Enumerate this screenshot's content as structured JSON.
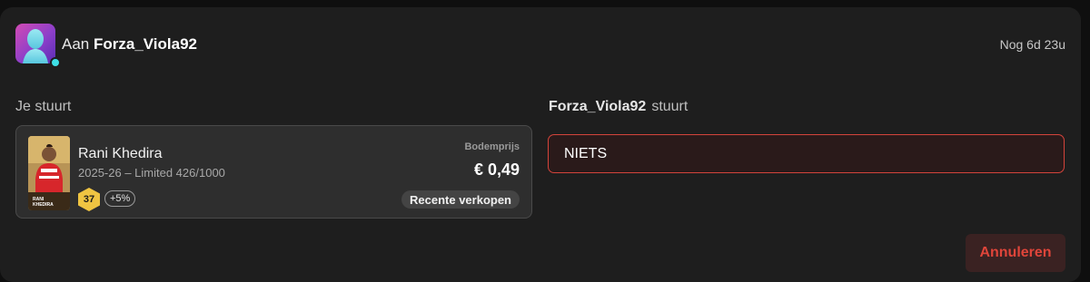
{
  "header": {
    "to_prefix": "Aan",
    "recipient": "Forza_Viola92",
    "time_left": "Nog 6d 23u",
    "avatar_icon": "person-silhouette-icon",
    "online_color": "#3ee0e6"
  },
  "you_send": {
    "label": "Je stuurt",
    "card": {
      "player_name": "Rani Khedira",
      "meta": "2025-26 – Limited 426/1000",
      "rating": "37",
      "bonus": "+5%",
      "floor_label": "Bodemprijs",
      "floor_price": "€ 0,49",
      "recent_sales_label": "Recente verkopen",
      "card_art_text": "RANI KHEDIRA"
    }
  },
  "they_send": {
    "user": "Forza_Viola92",
    "label": "stuurt",
    "value": "NIETS"
  },
  "actions": {
    "cancel_label": "Annuleren"
  },
  "colors": {
    "accent_red": "#d4443b",
    "rating_gold": "#f0c542"
  }
}
